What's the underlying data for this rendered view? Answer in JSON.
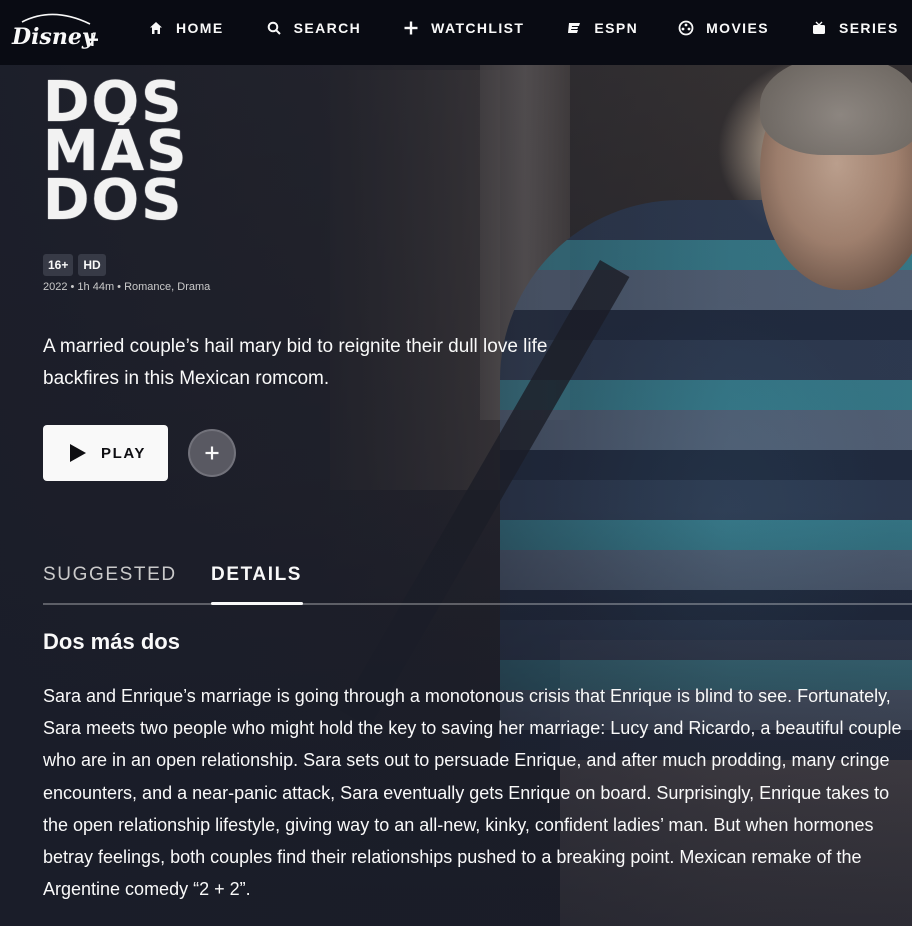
{
  "app": {
    "name": "Disney+",
    "logo_text": "Disney+"
  },
  "nav": {
    "items": [
      {
        "label": "HOME",
        "icon": "home-icon"
      },
      {
        "label": "SEARCH",
        "icon": "search-icon"
      },
      {
        "label": "WATCHLIST",
        "icon": "plus-icon"
      },
      {
        "label": "ESPN",
        "icon": "espn-icon"
      },
      {
        "label": "MOVIES",
        "icon": "movies-icon"
      },
      {
        "label": "SERIES",
        "icon": "tv-icon"
      }
    ],
    "overflow_icon": "star-icon"
  },
  "title": {
    "logo_lines": [
      "DOS",
      "MÁS",
      "DOS"
    ]
  },
  "badges": [
    "16+",
    "HD"
  ],
  "meta": "2022 • 1h 44m • Romance, Drama",
  "description": "A married couple’s hail mary bid to reignite their dull love life backfires in this Mexican romcom.",
  "actions": {
    "play_label": "PLAY",
    "add_icon": "plus-icon"
  },
  "tabs": [
    {
      "label": "SUGGESTED",
      "selected": false
    },
    {
      "label": "DETAILS",
      "selected": true
    }
  ],
  "details": {
    "title": "Dos más dos",
    "body": "Sara and Enrique’s marriage is going through a monotonous crisis that Enrique is blind to see. Fortunately, Sara meets two people who might hold the key to saving her marriage: Lucy and Ricardo, a beautiful couple who are in an open relationship. Sara sets out to persuade Enrique, and after much prodding, many cringe encounters, and a near-panic attack, Sara eventually gets Enrique on board. Surprisingly, Enrique takes to the open relationship lifestyle, giving way to an all-new, kinky, confident ladies’ man. But when hormones betray feelings, both couples find their relationships pushed to a breaking point. Mexican remake of the Argentine comedy “2 + 2”."
  },
  "colors": {
    "background": "#1a1d29",
    "header": "#090b13",
    "text": "#f9f9f9",
    "muted": "#cacaca"
  }
}
